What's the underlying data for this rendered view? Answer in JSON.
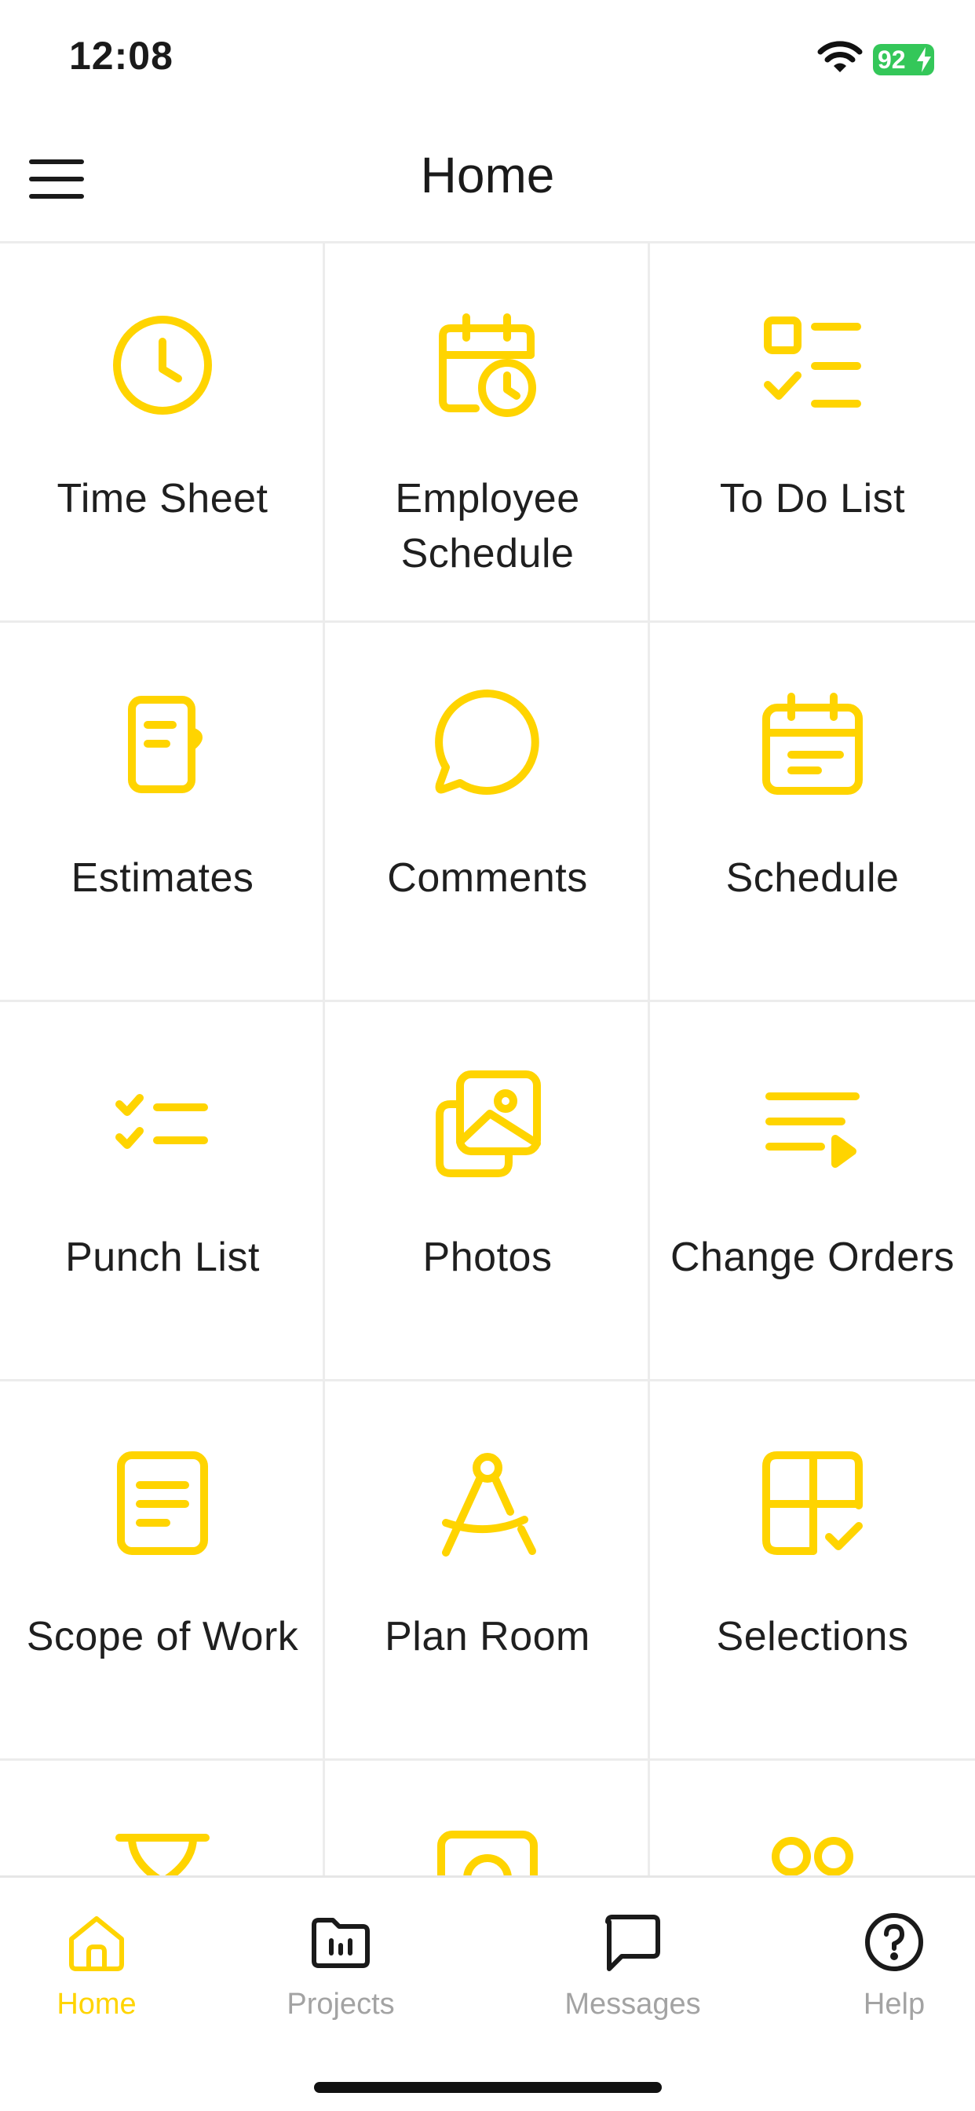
{
  "status_bar": {
    "time": "12:08",
    "battery": "92"
  },
  "header": {
    "title": "Home"
  },
  "colors": {
    "accent": "#FFD400",
    "text": "#1a1a1a",
    "inactive": "#a3a3a3",
    "divider": "#ececec",
    "battery": "#34c759"
  },
  "tiles": [
    {
      "label": "Time Sheet",
      "icon": "clock-icon"
    },
    {
      "label": "Employee Schedule",
      "icon": "calendar-clock-icon"
    },
    {
      "label": "To Do List",
      "icon": "checklist-icon"
    },
    {
      "label": "Estimates",
      "icon": "document-icon"
    },
    {
      "label": "Comments",
      "icon": "chat-bubble-icon"
    },
    {
      "label": "Schedule",
      "icon": "calendar-icon"
    },
    {
      "label": "Punch List",
      "icon": "check-list-icon"
    },
    {
      "label": "Photos",
      "icon": "photos-icon"
    },
    {
      "label": "Change Orders",
      "icon": "sort-list-icon"
    },
    {
      "label": "Scope of Work",
      "icon": "document-lines-icon"
    },
    {
      "label": "Plan Room",
      "icon": "compass-icon"
    },
    {
      "label": "Selections",
      "icon": "grid-check-icon"
    },
    {
      "label": "",
      "icon": "hourglass-icon"
    },
    {
      "label": "",
      "icon": "camera-icon"
    },
    {
      "label": "",
      "icon": "people-icon"
    }
  ],
  "tabbar": {
    "tabs": [
      {
        "label": "Home",
        "icon": "home-icon",
        "active": true
      },
      {
        "label": "Projects",
        "icon": "folder-icon",
        "active": false
      },
      {
        "label": "Messages",
        "icon": "message-icon",
        "active": false
      },
      {
        "label": "Help",
        "icon": "help-icon",
        "active": false
      }
    ]
  }
}
